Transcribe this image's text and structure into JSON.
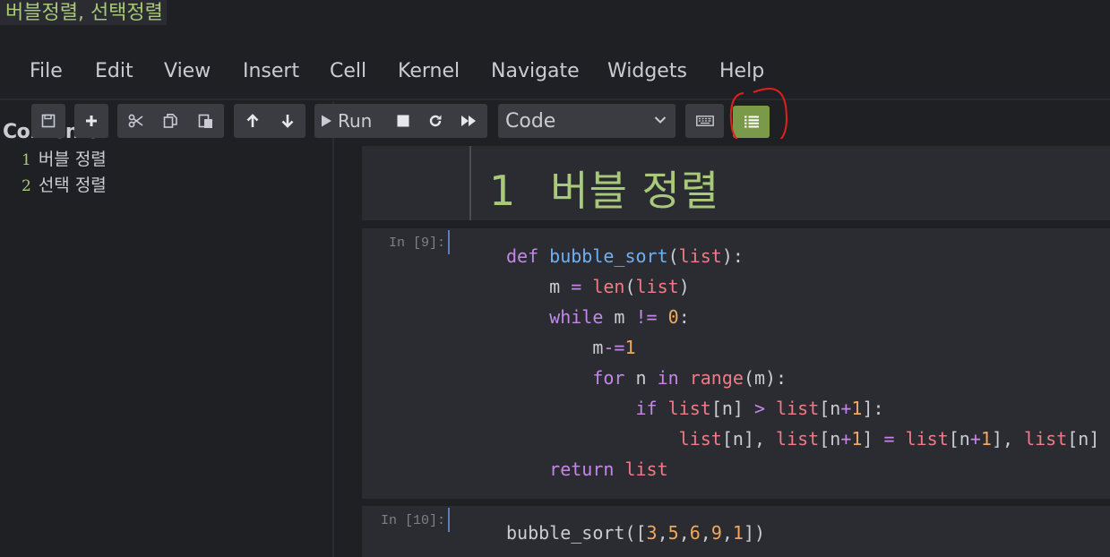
{
  "notebook": {
    "title": "버블정렬, 선택정렬"
  },
  "menu": [
    "File",
    "Edit",
    "View",
    "Insert",
    "Cell",
    "Kernel",
    "Navigate",
    "Widgets",
    "Help"
  ],
  "toc": {
    "title": "Contents",
    "items": [
      {
        "num": "1",
        "label": "버블 정렬"
      },
      {
        "num": "2",
        "label": "선택 정렬"
      }
    ]
  },
  "toolbar": {
    "run_label": "Run",
    "cell_type": "Code"
  },
  "cells": [
    {
      "type": "markdown",
      "heading_num": "1",
      "heading_text": "버블 정렬"
    },
    {
      "type": "code",
      "prompt": "In [9]:"
    },
    {
      "type": "code",
      "prompt": "In [10]:"
    }
  ],
  "colors": {
    "accent": "#a8c87a",
    "toc_button": "#7a9a4a",
    "annotation": "#e02020",
    "background": "#1f2023",
    "cell_bg": "#2b2c31"
  }
}
